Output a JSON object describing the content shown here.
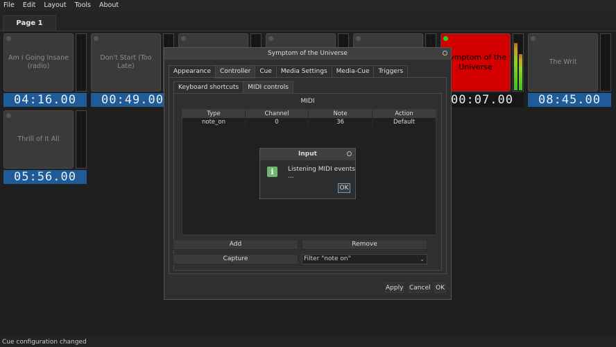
{
  "menu": [
    "File",
    "Edit",
    "Layout",
    "Tools",
    "About"
  ],
  "page_tab": "Page 1",
  "cues": [
    {
      "name": "Am I Going Insane (radio)",
      "time": "04:16.00",
      "selected": false
    },
    {
      "name": "Don't Start (Too Late)",
      "time": "00:49.00",
      "selected": false
    },
    {
      "name": "",
      "time": "",
      "selected": false
    },
    {
      "name": "",
      "time": "",
      "selected": false
    },
    {
      "name": "",
      "time": "",
      "selected": false
    },
    {
      "name": "Symptom of the Universe",
      "time": "00:07.00",
      "selected": true
    },
    {
      "name": "The Writ",
      "time": "08:45.00",
      "selected": false
    },
    {
      "name": "Thrill of It All",
      "time": "05:56.00",
      "selected": false
    }
  ],
  "meter_levels": {
    "cue6": [
      0.85,
      0.65
    ]
  },
  "dialog": {
    "title": "Symptom of the Universe",
    "tabs": [
      "Appearance",
      "Controller",
      "Cue",
      "Media Settings",
      "Media-Cue",
      "Triggers"
    ],
    "subtabs": [
      "Keyboard shortcuts",
      "MIDI controls"
    ],
    "group": "MIDI",
    "table": {
      "columns": [
        "Type",
        "Channel",
        "Note",
        "Action"
      ],
      "rows": [
        [
          "note_on",
          "0",
          "36",
          "Default"
        ]
      ]
    },
    "add": "Add",
    "remove": "Remove",
    "capture": "Capture",
    "filter": "Filter \"note on\"",
    "apply": "Apply",
    "cancel": "Cancel",
    "ok": "OK"
  },
  "popup": {
    "title": "Input",
    "message": "Listening MIDI events ...",
    "ok": "OK"
  },
  "status": "Cue configuration changed"
}
